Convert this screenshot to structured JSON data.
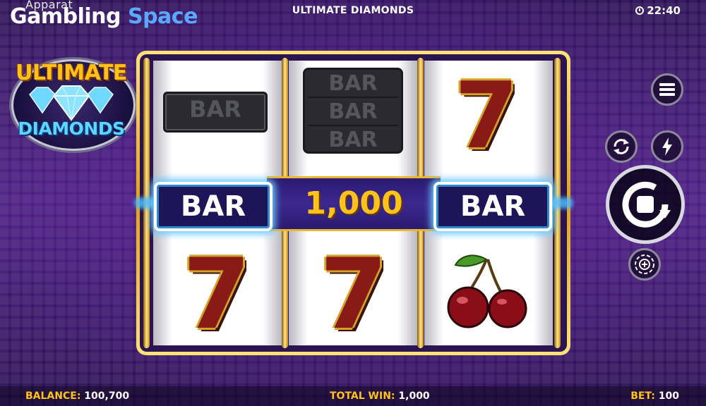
{
  "brand": {
    "small": "Apparat",
    "word1": "Gambling",
    "word2": "Space"
  },
  "game_title": "ULTIMATE DIAMONDS",
  "clock": {
    "time": "22:40"
  },
  "logo": {
    "top": "ULTIMATE",
    "bottom": "DIAMONDS"
  },
  "reels": {
    "reel1": {
      "top": "BAR",
      "middle": "BAR",
      "bottom": "7"
    },
    "reel2": {
      "top": [
        "BAR",
        "BAR",
        "BAR"
      ],
      "bottom": "7"
    },
    "reel3": {
      "top": "7",
      "middle": "BAR",
      "bottom": "cherry"
    }
  },
  "win": {
    "amount": "1,000"
  },
  "controls": {
    "menu_icon": "menu-icon",
    "autoplay_icon": "autoplay-icon",
    "turbo_icon": "lightning-icon",
    "spin_icon": "spin-icon",
    "bet_icon": "bet-chip-icon"
  },
  "footer": {
    "balance_label": "BALANCE:",
    "balance_value": "100,700",
    "total_win_label": "TOTAL WIN:",
    "total_win_value": "1,000",
    "bet_label": "BET:",
    "bet_value": "100"
  },
  "colors": {
    "accent": "#ffc21a",
    "brand_blue": "#5aa8ff",
    "background": "#3b1766",
    "glow": "#6ac8ff"
  }
}
